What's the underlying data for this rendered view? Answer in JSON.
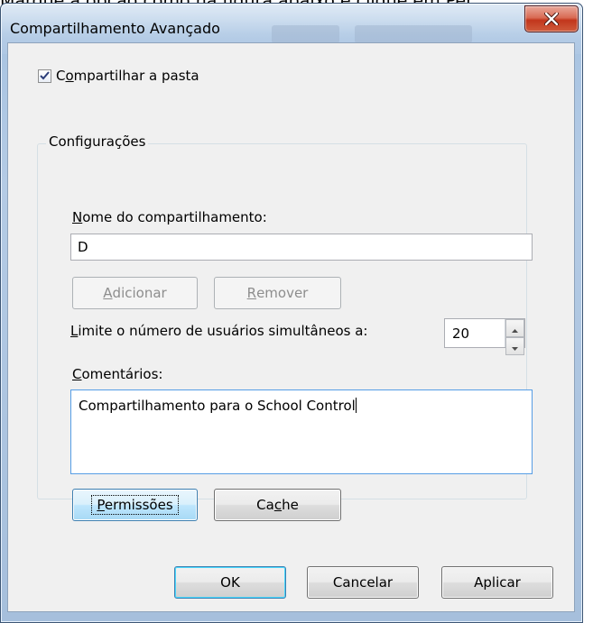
{
  "caption": "Marque a opção como na figura abaixo e clique em Per",
  "window": {
    "title": "Compartilhamento Avançado"
  },
  "share_checkbox": {
    "label_pre": "C",
    "label_u": "o",
    "label_post": "mpartilhar a pasta",
    "checked": true
  },
  "settings": {
    "group_label": "Configurações",
    "share_name": {
      "label_u": "N",
      "label_post": "ome do compartilhamento:",
      "value": "D"
    },
    "add_button": {
      "u": "A",
      "rest": "dicionar",
      "disabled": true
    },
    "remove_button": {
      "u": "R",
      "rest": "emover",
      "disabled": true
    },
    "user_limit": {
      "label_u": "L",
      "label_post": "imite o número de usuários simultâneos a:",
      "value": "20"
    },
    "comments": {
      "label_u": "C",
      "label_post": "omentários:",
      "value": "Compartilhamento para o School Control"
    },
    "permissions_button": {
      "u": "P",
      "rest": "ermissões"
    },
    "cache_button": {
      "pre": "Ca",
      "u": "c",
      "post": "he"
    }
  },
  "footer": {
    "ok": "OK",
    "cancel": "Cancelar",
    "apply": "Aplicar"
  },
  "colors": {
    "close_button": "#c7462b",
    "dialog_bg": "#f0f0f0",
    "frame": "#aec7e3",
    "focus_blue": "#3c7fb1"
  },
  "icons": {
    "close": "close-icon",
    "check": "checkmark-icon",
    "spin_up": "chevron-up-icon",
    "spin_down": "chevron-down-icon"
  }
}
